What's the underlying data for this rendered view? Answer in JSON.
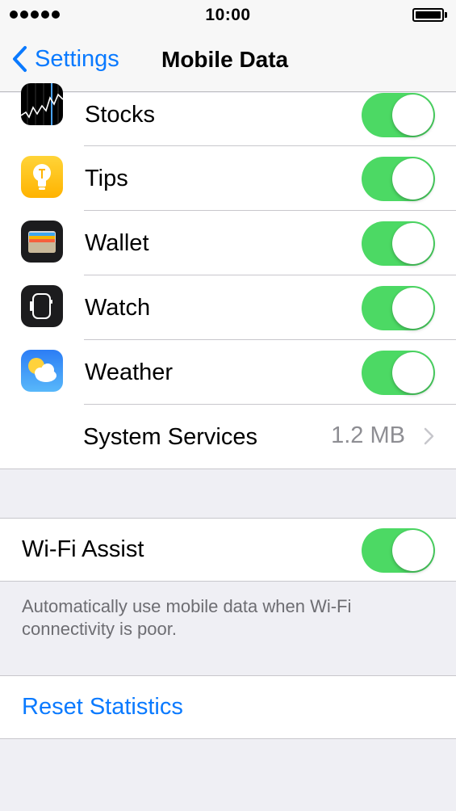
{
  "status_bar": {
    "time": "10:00",
    "signal_dots": 5
  },
  "nav": {
    "back_label": "Settings",
    "title": "Mobile Data"
  },
  "apps": [
    {
      "name": "Stocks",
      "icon": "stocks-icon",
      "enabled": true
    },
    {
      "name": "Tips",
      "icon": "tips-icon",
      "enabled": true
    },
    {
      "name": "Wallet",
      "icon": "wallet-icon",
      "enabled": true
    },
    {
      "name": "Watch",
      "icon": "watch-icon",
      "enabled": true
    },
    {
      "name": "Weather",
      "icon": "weather-icon",
      "enabled": true
    }
  ],
  "system_services": {
    "label": "System Services",
    "value": "1.2 MB"
  },
  "wifi_assist": {
    "label": "Wi-Fi Assist",
    "enabled": true,
    "footer": "Automatically use mobile data when Wi-Fi connectivity is poor."
  },
  "reset": {
    "label": "Reset Statistics"
  },
  "colors": {
    "accent": "#0a7aff",
    "toggle_on": "#4cd964",
    "background": "#efeff4"
  }
}
